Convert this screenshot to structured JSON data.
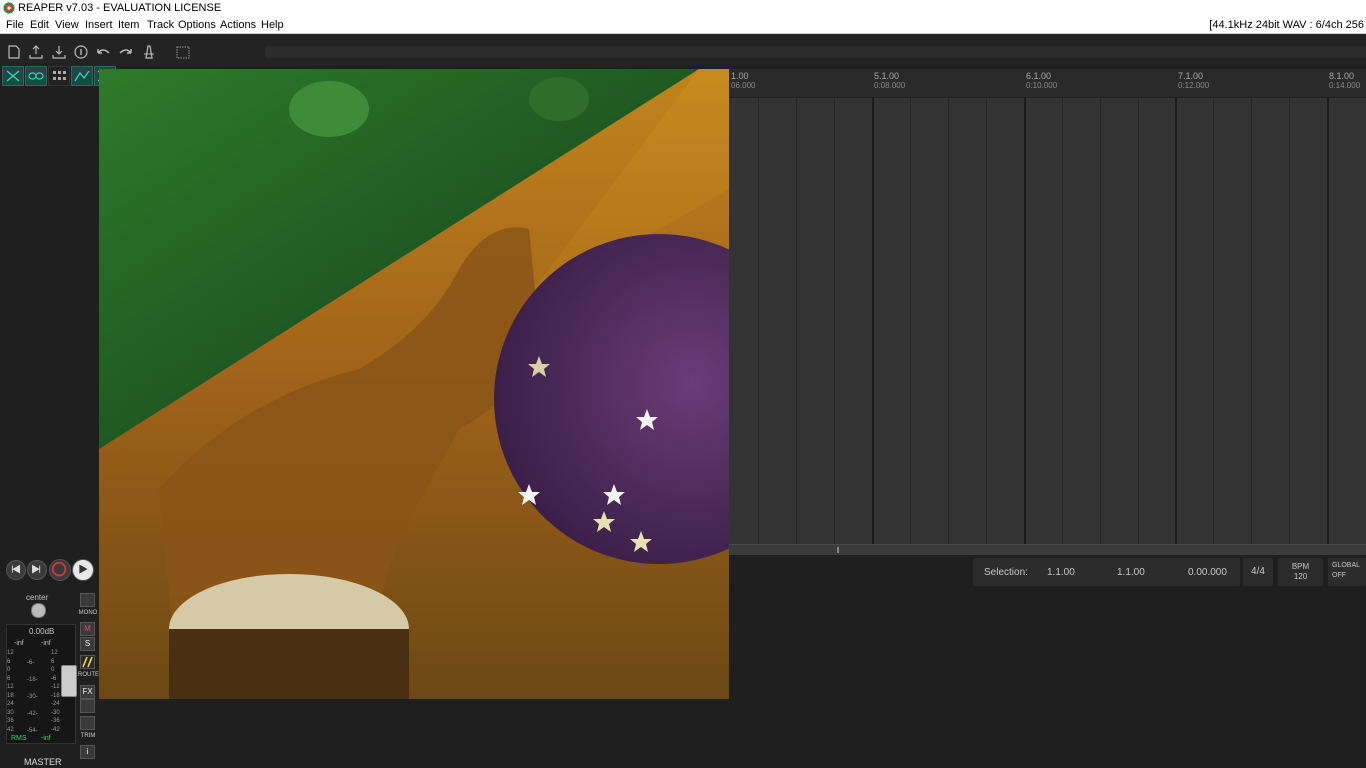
{
  "window": {
    "title": "REAPER v7.03 - EVALUATION LICENSE"
  },
  "menu": {
    "items": [
      "File",
      "Edit",
      "View",
      "Insert",
      "Item",
      "Track",
      "Options",
      "Actions",
      "Help"
    ],
    "status": "[44.1kHz 24bit WAV : 6/4ch 256"
  },
  "toolbar": {
    "icons": [
      "new-project-icon",
      "open-project-icon",
      "save-project-icon",
      "project-settings-icon",
      "undo-icon",
      "redo-icon",
      "metronome-icon",
      "grid-icon"
    ]
  },
  "ruler": {
    "marks": [
      {
        "bar": "1.00",
        "time": "06.000"
      },
      {
        "bar": "5.1.00",
        "time": "0:08.000"
      },
      {
        "bar": "6.1.00",
        "time": "0:10.000"
      },
      {
        "bar": "7.1.00",
        "time": "0:12.000"
      },
      {
        "bar": "8.1.00",
        "time": "0:14.000"
      }
    ]
  },
  "selection": {
    "label": "Selection:",
    "start": "1.1.00",
    "end": "1.1.00",
    "length": "0.00.000"
  },
  "time_signature": "4/4",
  "bpm": {
    "label": "BPM",
    "value": "120"
  },
  "global_auto": {
    "label": "GLOBAL",
    "state": "OFF"
  },
  "master": {
    "pan": "center",
    "volume": "0.00dB",
    "peak_left": "-inf",
    "peak_right": "-inf",
    "scale_left": [
      "12",
      "6",
      "0",
      "6",
      "12",
      "18",
      "24",
      "30",
      "36",
      "42"
    ],
    "scale_mid": [
      "-6-",
      "-18-",
      "-30-",
      "-42-",
      "-54-"
    ],
    "scale_right": [
      "12",
      "6",
      "0",
      "-6",
      "-12",
      "-18",
      "-24",
      "-30",
      "-36",
      "-42"
    ],
    "rms_label": "RMS",
    "rms_value": "-inf",
    "name": "MASTER",
    "buttons": {
      "mono": "MONO",
      "mute": "M",
      "solo": "S",
      "route": "ROUTE",
      "fx": "FX",
      "trim": "TRIM",
      "info": "i"
    }
  },
  "colors": {
    "accent_teal": "#1a4a43",
    "record": "#d33a3a",
    "background": "#1f1f1f",
    "arrange_bg": "#333333"
  }
}
